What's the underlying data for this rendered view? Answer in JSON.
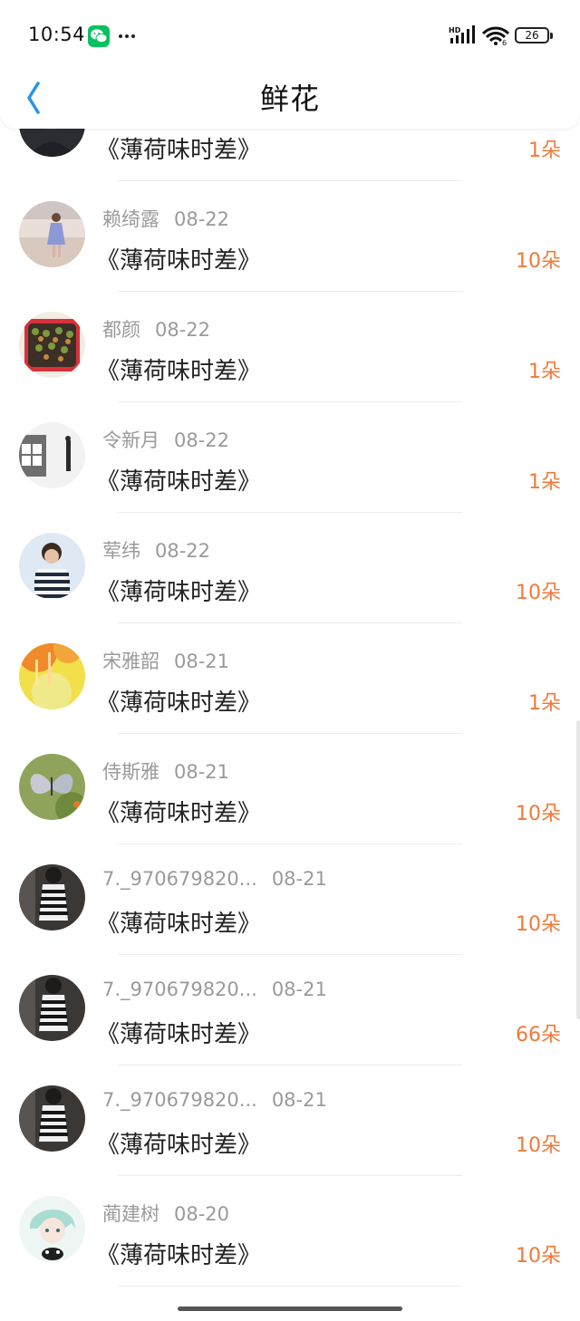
{
  "status_bar": {
    "time": "10:54",
    "battery": "26",
    "signal_label": "HD",
    "wifi_label": "6"
  },
  "header": {
    "title": "鲜花"
  },
  "colors": {
    "qty": "#ef7a3a",
    "meta": "#9a9a9a",
    "accent_back": "#2a93e8",
    "wechat": "#07c160"
  },
  "list": [
    {
      "name": "",
      "date": "",
      "gift": "《薄荷味时差》",
      "qty": "1朵",
      "avatar_icon": "person-photo-avatar"
    },
    {
      "name": "赖绮露",
      "date": "08-22",
      "gift": "《薄荷味时差》",
      "qty": "10朵",
      "avatar_icon": "girl-on-beach-avatar"
    },
    {
      "name": "都颜",
      "date": "08-22",
      "gift": "《薄荷味时差》",
      "qty": "1朵",
      "avatar_icon": "food-tray-avatar"
    },
    {
      "name": "令新月",
      "date": "08-22",
      "gift": "《薄荷味时差》",
      "qty": "1朵",
      "avatar_icon": "uniqlo-avatar"
    },
    {
      "name": "荤纬",
      "date": "08-22",
      "gift": "《薄荷味时差》",
      "qty": "10朵",
      "avatar_icon": "kid-striped-shirt-avatar"
    },
    {
      "name": "宋雅韶",
      "date": "08-21",
      "gift": "《薄荷味时差》",
      "qty": "1朵",
      "avatar_icon": "orange-yellow-abstract-avatar"
    },
    {
      "name": "侍斯雅",
      "date": "08-21",
      "gift": "《薄荷味时差》",
      "qty": "10朵",
      "avatar_icon": "butterfly-avatar"
    },
    {
      "name": "7._970679820...",
      "date": "08-21",
      "gift": "《薄荷味时差》",
      "qty": "10朵",
      "avatar_icon": "striped-dress-girl-avatar"
    },
    {
      "name": "7._970679820...",
      "date": "08-21",
      "gift": "《薄荷味时差》",
      "qty": "66朵",
      "avatar_icon": "striped-dress-girl-avatar"
    },
    {
      "name": "7._970679820...",
      "date": "08-21",
      "gift": "《薄荷味时差》",
      "qty": "10朵",
      "avatar_icon": "striped-dress-girl-avatar"
    },
    {
      "name": "蔺建树",
      "date": "08-20",
      "gift": "《薄荷味时差》",
      "qty": "10朵",
      "avatar_icon": "anime-boy-avatar"
    }
  ]
}
